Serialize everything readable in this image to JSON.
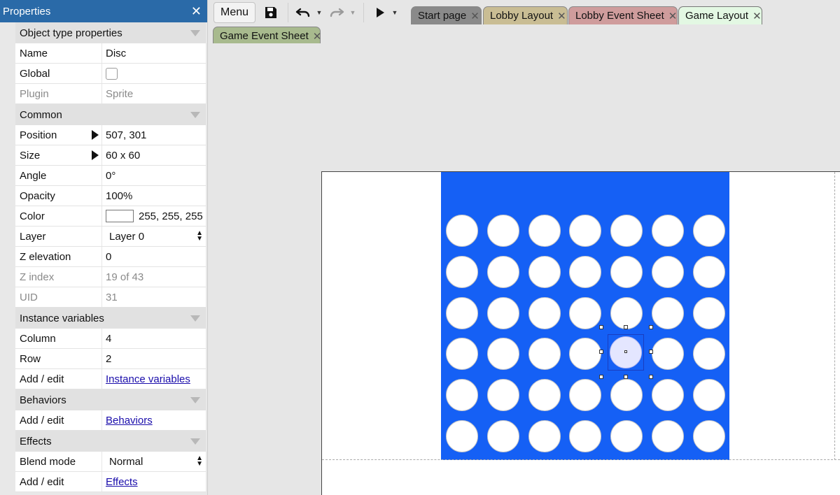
{
  "properties_panel": {
    "title": "Properties",
    "sections": {
      "object_type": {
        "label": "Object type properties",
        "name": {
          "label": "Name",
          "value": "Disc"
        },
        "global": {
          "label": "Global",
          "checked": false
        },
        "plugin": {
          "label": "Plugin",
          "value": "Sprite"
        }
      },
      "common": {
        "label": "Common",
        "position": {
          "label": "Position",
          "value": "507, 301"
        },
        "size": {
          "label": "Size",
          "value": "60 x 60"
        },
        "angle": {
          "label": "Angle",
          "value": "0°"
        },
        "opacity": {
          "label": "Opacity",
          "value": "100%"
        },
        "color": {
          "label": "Color",
          "value": "255, 255, 255",
          "swatch": "#ffffff"
        },
        "layer": {
          "label": "Layer",
          "value": "Layer 0"
        },
        "z_elevation": {
          "label": "Z elevation",
          "value": "0"
        },
        "z_index": {
          "label": "Z index",
          "value": "19 of 43"
        },
        "uid": {
          "label": "UID",
          "value": "31"
        }
      },
      "instance_variables": {
        "label": "Instance variables",
        "column": {
          "label": "Column",
          "value": "4"
        },
        "row": {
          "label": "Row",
          "value": "2"
        },
        "add_edit": {
          "label": "Add / edit",
          "link": "Instance variables"
        }
      },
      "behaviors": {
        "label": "Behaviors",
        "add_edit": {
          "label": "Add / edit",
          "link": "Behaviors"
        }
      },
      "effects": {
        "label": "Effects",
        "blend_mode": {
          "label": "Blend mode",
          "value": "Normal"
        },
        "add_edit": {
          "label": "Add / edit",
          "link": "Effects"
        }
      }
    }
  },
  "toolbar": {
    "menu_label": "Menu",
    "icons": [
      "save-icon",
      "undo-icon",
      "redo-icon",
      "play-icon"
    ]
  },
  "tabs": [
    {
      "label": "Start page",
      "color": "#8a8a8a",
      "active": false
    },
    {
      "label": "Lobby Layout",
      "color": "#c9bd94",
      "active": false
    },
    {
      "label": "Lobby Event Sheet",
      "color": "#cf9c9c",
      "active": false
    },
    {
      "label": "Game Layout",
      "color": "#e3f8e3",
      "active": true
    },
    {
      "label": "Game Event Sheet",
      "color": "#a8ba8e",
      "active": false
    }
  ],
  "layout": {
    "board_color": "#1560f5",
    "board_columns": 7,
    "board_rows": 6,
    "selected_column": 4,
    "selected_row": 3
  }
}
